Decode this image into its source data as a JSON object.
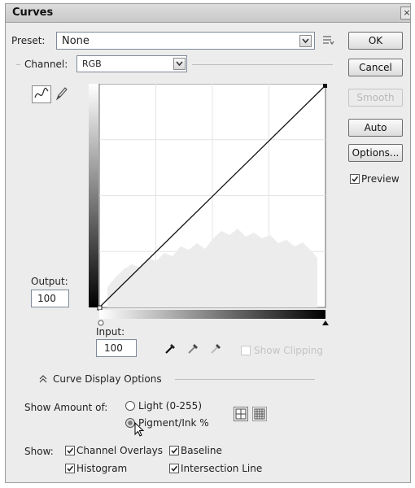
{
  "dialog": {
    "title": "Curves"
  },
  "preset": {
    "label": "Preset:",
    "value": "None"
  },
  "channel": {
    "label": "Channel:",
    "value": "RGB"
  },
  "buttons": {
    "ok": "OK",
    "cancel": "Cancel",
    "smooth": "Smooth",
    "auto": "Auto",
    "options": "Options..."
  },
  "preview": {
    "label": "Preview",
    "checked": true
  },
  "output": {
    "label": "Output:",
    "value": "100"
  },
  "input": {
    "label": "Input:",
    "value": "100"
  },
  "clipping": {
    "label": "Show Clipping"
  },
  "curve_display_options": {
    "label": "Curve Display Options"
  },
  "show_amount": {
    "label": "Show Amount of:",
    "options": [
      "Light  (0-255)",
      "Pigment/Ink %"
    ],
    "selected": "Pigment/Ink %"
  },
  "show": {
    "label": "Show:",
    "items": [
      "Channel Overlays",
      "Baseline",
      "Histogram",
      "Intersection Line"
    ]
  },
  "icons": [
    "curve-tool-icon",
    "pencil-icon",
    "preset-menu-icon",
    "black-eyedropper-icon",
    "gray-eyedropper-icon",
    "white-eyedropper-icon",
    "simple-grid-icon",
    "detailed-grid-icon",
    "collapse-chevron-icon",
    "cursor-arrow-icon"
  ]
}
